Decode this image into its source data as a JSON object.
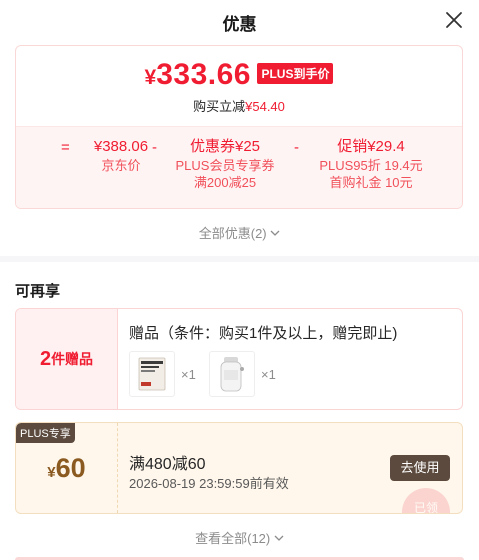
{
  "header": {
    "title": "优惠",
    "close_icon": "close-icon"
  },
  "price": {
    "currency": "¥",
    "final_price": "333.66",
    "plus_tag": "PLUS到手价",
    "saving_label": "购买立减",
    "saving_value": "¥54.40"
  },
  "breakdown": {
    "op_equals": "=",
    "op_minus_1": "-",
    "op_minus_2": "-",
    "jd_price_value": "¥388.06",
    "jd_price_label": "京东价",
    "coupon_value": "优惠券¥25",
    "coupon_label_1": "PLUS会员专享券",
    "coupon_label_2": "满200减25",
    "promo_value": "促销¥29.4",
    "promo_label_1": "PLUS95折 19.4元",
    "promo_label_2": "首购礼金 10元"
  },
  "all_discounts_link": "全部优惠(2)",
  "section": {
    "title": "可再享"
  },
  "gift": {
    "count": "2",
    "count_suffix": "件赠品",
    "condition": "赠品（条件：购买1件及以上，赠完即止)",
    "items": [
      {
        "qty": "×1",
        "icon": "product-pouch-image"
      },
      {
        "qty": "×1",
        "icon": "product-bottle-image"
      }
    ]
  },
  "coupon": {
    "tag": "PLUS专享",
    "currency": "¥",
    "amount": "60",
    "rule": "满480减60",
    "valid_until": "2026-08-19 23:59:59前有效",
    "use_button": "去使用",
    "stamp_text": "已领"
  },
  "view_all_link": "查看全部(12)",
  "colors": {
    "accent": "#f01d32",
    "plus_brown": "#5b4a3d",
    "coupon_bg": "#fff7ec"
  }
}
